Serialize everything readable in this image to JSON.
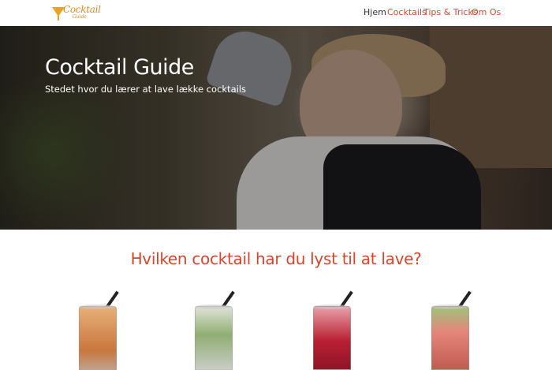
{
  "nav": {
    "logo_text": "Cocktail",
    "logo_sub": "Guide",
    "items": [
      {
        "label": "Hjem",
        "active": true
      },
      {
        "label": "Cocktails",
        "active": false
      },
      {
        "label": "Tips & Tricks",
        "active": false
      },
      {
        "label": "Om Os",
        "active": false
      }
    ]
  },
  "hero": {
    "title": "Cocktail Guide",
    "subtitle": "Stedet hvor du lærer at lave lække cocktails"
  },
  "section": {
    "title": "Hvilken cocktail har du lyst til at lave?"
  },
  "drinks": [
    {
      "icon": "cocktail-orange-image",
      "color": "#d9914f"
    },
    {
      "icon": "cocktail-mojito-image",
      "color": "#9fb88a"
    },
    {
      "icon": "cocktail-red-image",
      "color": "#b8243a"
    },
    {
      "icon": "cocktail-pink-image",
      "color": "#d8706a"
    }
  ],
  "colors": {
    "accent": "#d9452b",
    "logo": "#e08a1a"
  }
}
